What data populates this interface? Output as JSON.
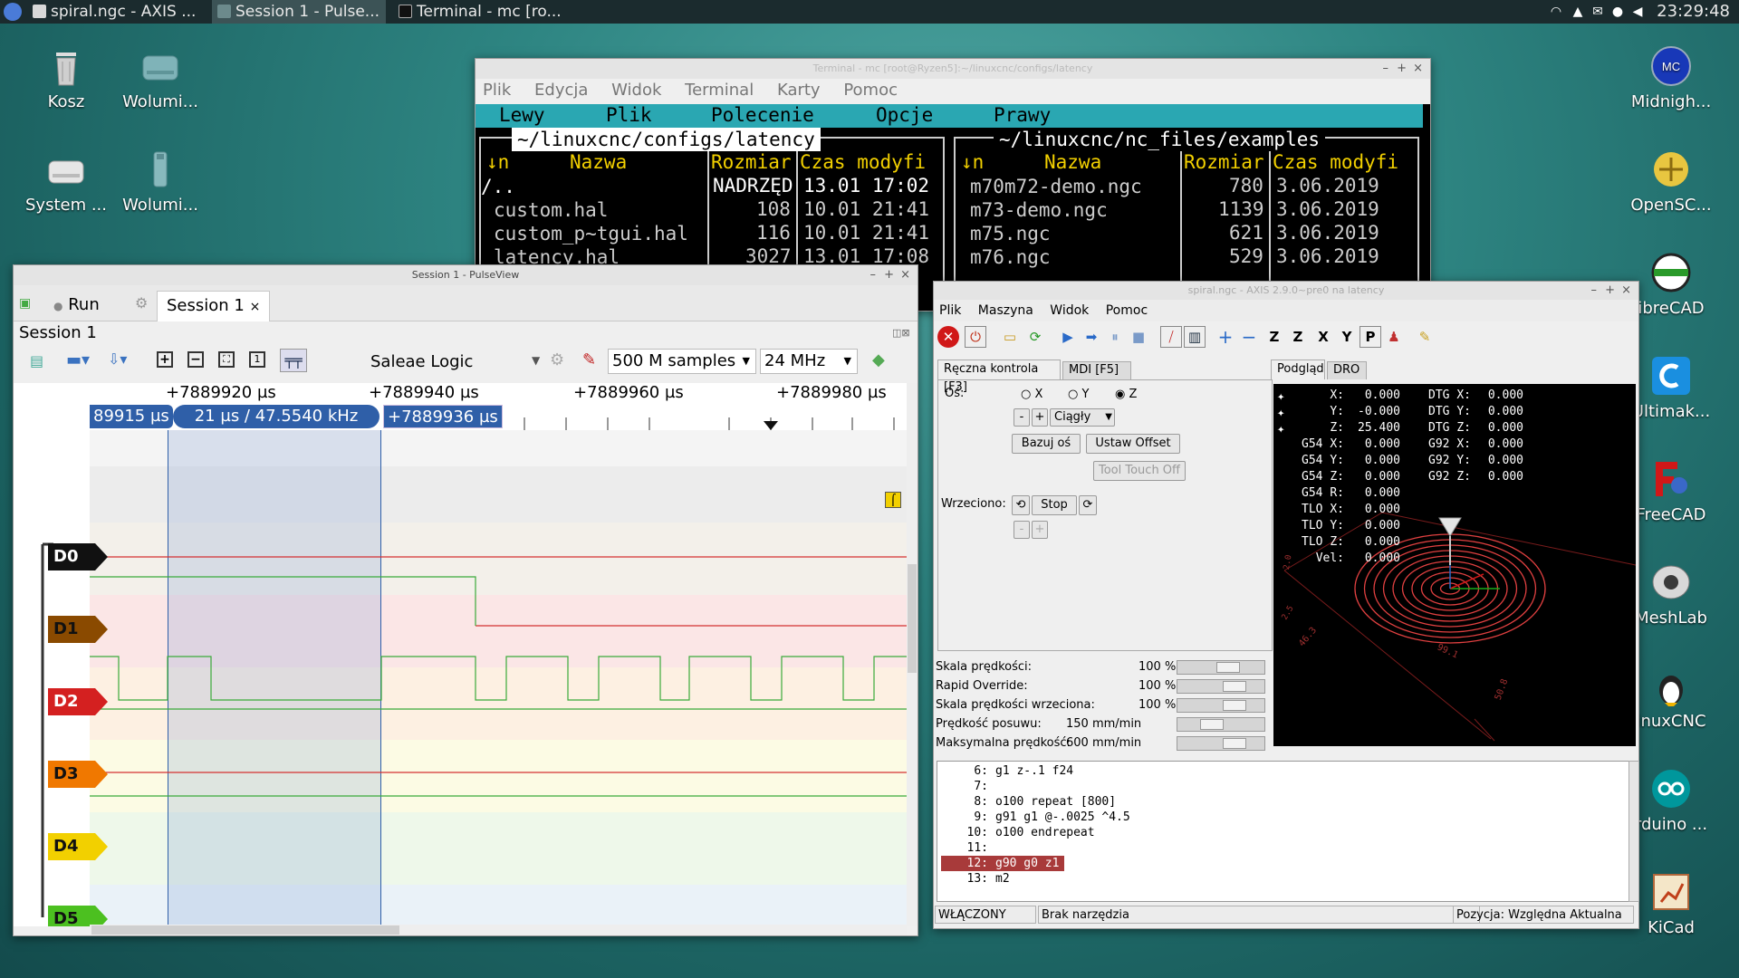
{
  "taskbar": {
    "tasks": [
      "spiral.ngc - AXIS ...",
      "Session 1 - Pulse...",
      "Terminal - mc [ro..."
    ],
    "clock": "23:29:48"
  },
  "desktop_left": [
    {
      "label": "Kosz",
      "icon": "trash-icon"
    },
    {
      "label": "Wolumi...",
      "icon": "drive-icon"
    },
    {
      "label": "System ...",
      "icon": "drive-icon"
    },
    {
      "label": "Wolumi...",
      "icon": "usb-drive-icon"
    }
  ],
  "desktop_right": [
    {
      "label": "Midnigh...",
      "icon": "midnight-commander-icon"
    },
    {
      "label": "OpenSC...",
      "icon": "openscad-icon"
    },
    {
      "label": "ibreCAD",
      "icon": "librecad-icon"
    },
    {
      "label": "Ultimak...",
      "icon": "ultimaker-cura-icon"
    },
    {
      "label": "FreeCAD",
      "icon": "freecad-icon"
    },
    {
      "label": "MeshLab",
      "icon": "meshlab-icon"
    },
    {
      "label": "inuxCNC",
      "icon": "linuxcnc-icon"
    },
    {
      "label": "rduino ...",
      "icon": "arduino-icon"
    },
    {
      "label": "KiCad",
      "icon": "kicad-icon"
    }
  ],
  "terminal": {
    "title": "Terminal - mc [root@Ryzen5]:~/linuxcnc/configs/latency",
    "menu": [
      "Plik",
      "Edycja",
      "Widok",
      "Terminal",
      "Karty",
      "Pomoc"
    ],
    "mc_menu": [
      "Lewy",
      "Plik",
      "Polecenie",
      "Opcje",
      "Prawy"
    ],
    "left_path": "~/linuxcnc/configs/latency",
    "right_path": "~/linuxcnc/nc_files/examples",
    "col_n": "↓n",
    "col_name": "Nazwa",
    "col_size": "Rozmiar",
    "col_mtime": "Czas modyfi",
    "left_rows": [
      {
        "name": "/..",
        "size": "NADRZĘD",
        "date": "13.01 17:02"
      },
      {
        "name": "custom.hal",
        "size": "108",
        "date": "10.01 21:41"
      },
      {
        "name": "custom_p~tgui.hal",
        "size": "116",
        "date": "10.01 21:41"
      },
      {
        "name": "latency.hal",
        "size": "3027",
        "date": "13.01 17:08"
      }
    ],
    "right_rows": [
      {
        "name": "m70m72-demo.ngc",
        "size": "780",
        "date": "3.06.2019"
      },
      {
        "name": "m73-demo.ngc",
        "size": "1139",
        "date": "3.06.2019"
      },
      {
        "name": "m75.ngc",
        "size": "621",
        "date": "3.06.2019"
      },
      {
        "name": "m76.ngc",
        "size": "529",
        "date": "3.06.2019"
      }
    ]
  },
  "pulseview": {
    "title": "Session 1 - PulseView",
    "run_label": "Run",
    "tab_label": "Session 1",
    "session_label": "Session 1",
    "device": "Saleae Logic",
    "samples": "500 M samples",
    "rate": "24 MHz",
    "ruler": [
      "+7889920 µs",
      "+7889940 µs",
      "+7889960 µs",
      "+7889980 µs"
    ],
    "cursor_left": "89915 µs",
    "cursor_mid": "21 µs / 47.5540 kHz",
    "cursor_right": "+7889936 µs",
    "channels": [
      {
        "name": "D0",
        "color": "#111111"
      },
      {
        "name": "D1",
        "color": "#8a4a00"
      },
      {
        "name": "D2",
        "color": "#d42020"
      },
      {
        "name": "D3",
        "color": "#f07800"
      },
      {
        "name": "D4",
        "color": "#f2d000"
      },
      {
        "name": "D5",
        "color": "#4cc020"
      }
    ]
  },
  "axis": {
    "title": "spiral.ngc - AXIS 2.9.0~pre0 na latency",
    "menu": [
      "Plik",
      "Maszyna",
      "Widok",
      "Pomoc"
    ],
    "tab_manual": "Ręczna kontrola [F3]",
    "tab_mdi": "MDI [F5]",
    "tab_preview": "Podgląd",
    "tab_dro": "DRO",
    "axis_label": "Oś:",
    "axes": [
      "X",
      "Y",
      "Z"
    ],
    "jog_minus": "-",
    "jog_plus": "+",
    "jog_mode": "Ciągły",
    "home_button": "Bazuj oś",
    "offset_button": "Ustaw Offset",
    "touch_button": "Tool Touch Off",
    "spindle_label": "Wrzeciono:",
    "stop_button": "Stop",
    "overrides": [
      {
        "label": "Skala prędkości:",
        "value": "100 %",
        "level": 0.62
      },
      {
        "label": "Rapid Override:",
        "value": "100 %",
        "level": 0.72
      },
      {
        "label": "Skala prędkości wrzeciona:",
        "value": "100 %",
        "level": 0.72
      },
      {
        "label": "Prędkość posuwu:",
        "value": "150 mm/min",
        "level": 0.36
      },
      {
        "label": "Maksymalna prędkość:",
        "value": "600 mm/min",
        "level": 0.72
      }
    ],
    "dro": [
      {
        "a": "X:",
        "av": "0.000",
        "b": "DTG X:",
        "bv": "0.000"
      },
      {
        "a": "Y:",
        "av": "-0.000",
        "b": "DTG Y:",
        "bv": "0.000"
      },
      {
        "a": "Z:",
        "av": "25.400",
        "b": "DTG Z:",
        "bv": "0.000"
      },
      {
        "a": "G54 X:",
        "av": "0.000",
        "b": "G92 X:",
        "bv": "0.000"
      },
      {
        "a": "G54 Y:",
        "av": "0.000",
        "b": "G92 Y:",
        "bv": "0.000"
      },
      {
        "a": "G54 Z:",
        "av": "0.000",
        "b": "G92 Z:",
        "bv": "0.000"
      },
      {
        "a": "G54 R:",
        "av": "0.000",
        "b": "",
        "bv": ""
      },
      {
        "a": "TLO X:",
        "av": "0.000",
        "b": "",
        "bv": ""
      },
      {
        "a": "TLO Y:",
        "av": "0.000",
        "b": "",
        "bv": ""
      },
      {
        "a": "TLO Z:",
        "av": "0.000",
        "b": "",
        "bv": ""
      },
      {
        "a": "Vel:",
        "av": "0.000",
        "b": "",
        "bv": ""
      }
    ],
    "preview_labels": [
      "2.0",
      "2.5",
      "46.3",
      "99.1",
      "50.8"
    ],
    "gcode": [
      {
        "n": "6:",
        "t": "g1 z-.1 f24"
      },
      {
        "n": "7:",
        "t": ""
      },
      {
        "n": "8:",
        "t": "o100 repeat [800]"
      },
      {
        "n": "9:",
        "t": "g91 g1 @-.0025 ^4.5"
      },
      {
        "n": "10:",
        "t": "o100 endrepeat"
      },
      {
        "n": "11:",
        "t": ""
      },
      {
        "n": "12:",
        "t": "g90 g0 z1"
      },
      {
        "n": "13:",
        "t": "m2"
      }
    ],
    "status": {
      "state": "WŁĄCZONY",
      "tool": "Brak narzędzia",
      "position": "Pozycja: Względna Aktualna"
    }
  },
  "colors": {
    "trace_red": "#d43030",
    "trace_green": "#3aaa3a",
    "cursor_blue": "#2f5fa8",
    "dro_red": "#ff4a4a"
  }
}
